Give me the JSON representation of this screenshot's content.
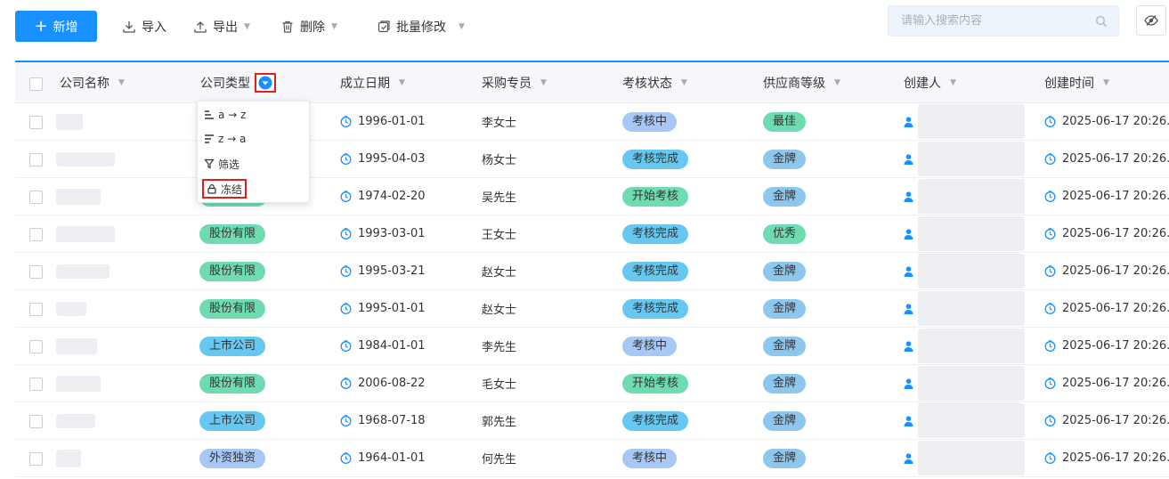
{
  "toolbar": {
    "add_label": "新增",
    "import_label": "导入",
    "export_label": "导出",
    "delete_label": "删除",
    "batch_edit_label": "批量修改",
    "search_placeholder": "请输入搜索内容"
  },
  "columns": [
    "公司名称",
    "公司类型",
    "成立日期",
    "采购专员",
    "考核状态",
    "供应商等级",
    "创建人",
    "创建时间"
  ],
  "sort_menu": {
    "asc": "a → z",
    "desc": "z → a",
    "filter": "筛选",
    "freeze": "冻结"
  },
  "rows": [
    {
      "type": "",
      "date": "1996-01-01",
      "buyer": "李女士",
      "status": "考核中",
      "grade": "最佳",
      "created": "2025-06-17 20:26..."
    },
    {
      "type": "",
      "date": "1995-04-03",
      "buyer": "杨女士",
      "status": "考核完成",
      "grade": "金牌",
      "created": "2025-06-17 20:26..."
    },
    {
      "type": "",
      "date": "1974-02-20",
      "buyer": "吴先生",
      "status": "开始考核",
      "grade": "金牌",
      "created": "2025-06-17 20:26..."
    },
    {
      "type": "股份有限",
      "date": "1993-03-01",
      "buyer": "王女士",
      "status": "考核完成",
      "grade": "优秀",
      "created": "2025-06-17 20:26..."
    },
    {
      "type": "股份有限",
      "date": "1995-03-21",
      "buyer": "赵女士",
      "status": "考核完成",
      "grade": "金牌",
      "created": "2025-06-17 20:26..."
    },
    {
      "type": "股份有限",
      "date": "1995-01-01",
      "buyer": "赵女士",
      "status": "考核完成",
      "grade": "金牌",
      "created": "2025-06-17 20:26..."
    },
    {
      "type": "上市公司",
      "date": "1984-01-01",
      "buyer": "李先生",
      "status": "考核中",
      "grade": "金牌",
      "created": "2025-06-17 20:26..."
    },
    {
      "type": "股份有限",
      "date": "2006-08-22",
      "buyer": "毛女士",
      "status": "开始考核",
      "grade": "金牌",
      "created": "2025-06-17 20:26..."
    },
    {
      "type": "上市公司",
      "date": "1968-07-18",
      "buyer": "郭先生",
      "status": "考核完成",
      "grade": "金牌",
      "created": "2025-06-17 20:26..."
    },
    {
      "type": "外资独资",
      "date": "1964-01-01",
      "buyer": "何先生",
      "status": "考核中",
      "grade": "金牌",
      "created": "2025-06-17 20:26..."
    }
  ],
  "colors": {
    "accent": "#1890ff",
    "highlight": "#e0201d"
  }
}
